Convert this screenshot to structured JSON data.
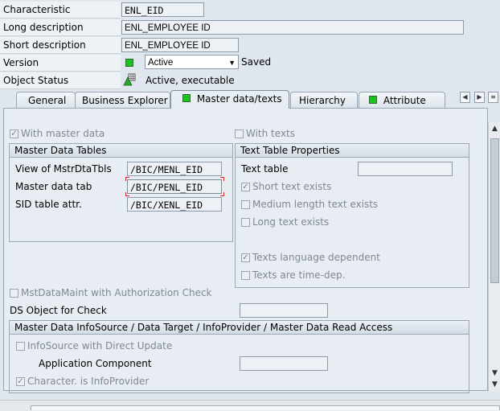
{
  "header": {
    "characteristic_label": "Characteristic",
    "characteristic_value": "ENL_EID",
    "long_desc_label": "Long description",
    "long_desc_value": "ENL_EMPLOYEE ID",
    "short_desc_label": "Short description",
    "short_desc_value": "ENL_EMPLOYEE ID",
    "version_label": "Version",
    "version_value": "Active",
    "version_saved": "Saved",
    "status_label": "Object Status",
    "status_value": "Active, executable"
  },
  "tabs": [
    {
      "label": "General"
    },
    {
      "label": "Business Explorer"
    },
    {
      "label": "Master data/texts"
    },
    {
      "label": "Hierarchy"
    },
    {
      "label": "Attribute"
    }
  ],
  "panel": {
    "with_master_data": "With master data",
    "with_texts": "With texts",
    "master_tables": {
      "title": "Master Data Tables",
      "rows": [
        {
          "label": "View of MstrDtaTbls",
          "value": "/BIC/MENL_EID"
        },
        {
          "label": "Master data tab",
          "value": "/BIC/PENL_EID"
        },
        {
          "label": "SID table attr.",
          "value": "/BIC/XENL_EID"
        }
      ]
    },
    "text_props": {
      "title": "Text Table Properties",
      "text_table_label": "Text table",
      "short_text": "Short text exists",
      "medium_text": "Medium length text exists",
      "long_text": "Long text exists",
      "lang_dependent": "Texts language dependent",
      "time_dep": "Texts are time-dep."
    },
    "auth_check": "MstDataMaint with Authorization Check",
    "ds_object_label": "DS Object for Check",
    "infosource_group": {
      "title": "Master Data InfoSource / Data Target / InfoProvider / Master Data Read Access",
      "direct_update": "InfoSource with Direct Update",
      "app_component_label": "Application Component",
      "is_infoprovider": "Character. is InfoProvider"
    }
  }
}
